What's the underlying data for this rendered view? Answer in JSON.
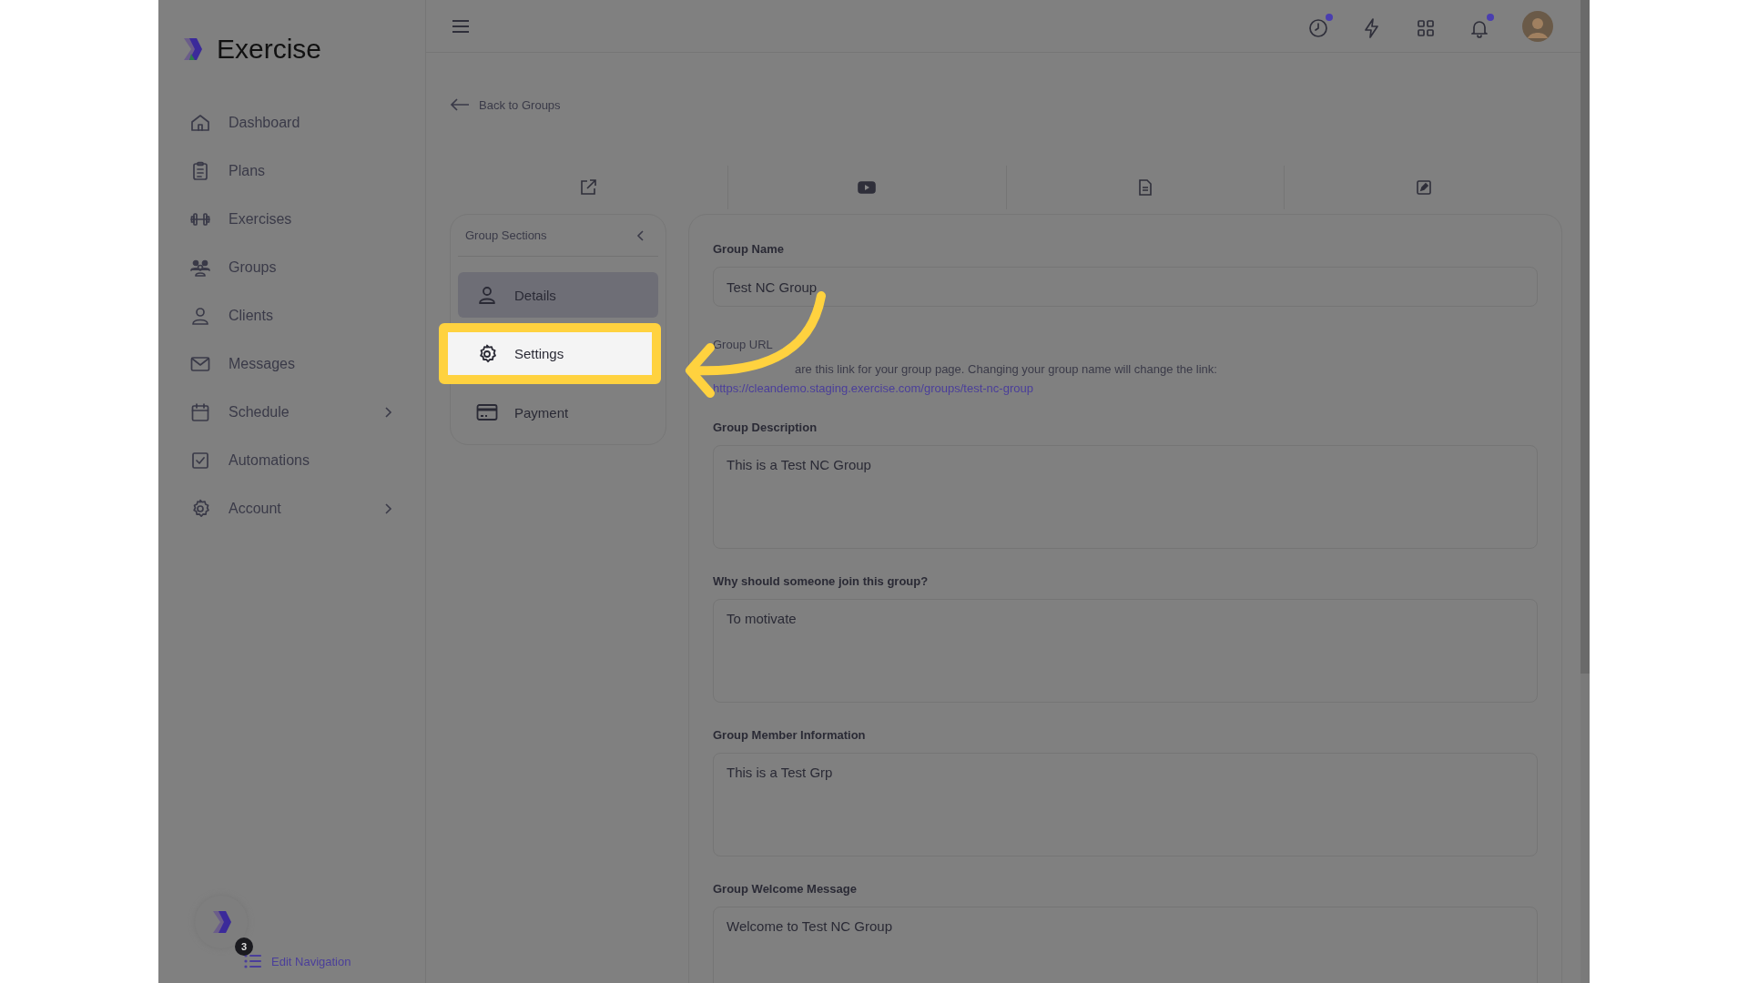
{
  "brand": {
    "name": "Exercise"
  },
  "sidebar": {
    "items": [
      {
        "label": "Dashboard",
        "kind": "home",
        "expandable": false
      },
      {
        "label": "Plans",
        "kind": "clipboard",
        "expandable": false
      },
      {
        "label": "Exercises",
        "kind": "dumbbell",
        "expandable": false
      },
      {
        "label": "Groups",
        "kind": "people",
        "expandable": false
      },
      {
        "label": "Clients",
        "kind": "person",
        "expandable": false
      },
      {
        "label": "Messages",
        "kind": "mail",
        "expandable": false
      },
      {
        "label": "Schedule",
        "kind": "calendar",
        "expandable": true
      },
      {
        "label": "Automations",
        "kind": "check",
        "expandable": false
      },
      {
        "label": "Account",
        "kind": "gear",
        "expandable": true
      }
    ],
    "badge": "3",
    "edit_navigation": "Edit Navigation"
  },
  "topbar": {
    "icons": [
      {
        "kind": "clock",
        "dot": true
      },
      {
        "kind": "bolt",
        "dot": false
      },
      {
        "kind": "grid",
        "dot": false
      },
      {
        "kind": "bell",
        "dot": true
      }
    ]
  },
  "back_link": "Back to Groups",
  "toolbar": [
    {
      "kind": "external"
    },
    {
      "kind": "video"
    },
    {
      "kind": "document"
    },
    {
      "kind": "edit"
    }
  ],
  "sections": {
    "title": "Group Sections",
    "items": [
      {
        "label": "Details",
        "kind": "person",
        "selected": true,
        "highlighted": false
      },
      {
        "label": "Settings",
        "kind": "gear",
        "selected": false,
        "highlighted": true
      },
      {
        "label": "Payment",
        "kind": "card",
        "selected": false,
        "highlighted": false
      }
    ]
  },
  "form": {
    "fields": [
      {
        "kind": "input",
        "label": "Group Name",
        "value": "Test NC Group"
      },
      {
        "kind": "link",
        "label": "Group URL",
        "description": "are this link for your group page. Changing your group name will change the link:",
        "url": "https://cleandemo.staging.exercise.com/groups/test-nc-group"
      },
      {
        "kind": "textarea",
        "label": "Group Description",
        "value": "This is a Test NC Group"
      },
      {
        "kind": "textarea",
        "label": "Why should someone join this group?",
        "value": "To motivate"
      },
      {
        "kind": "textarea",
        "label": "Group Member Information",
        "value": "This is a Test Grp"
      },
      {
        "kind": "textarea",
        "label": "Group Welcome Message",
        "value": "Welcome to Test NC Group"
      }
    ]
  }
}
